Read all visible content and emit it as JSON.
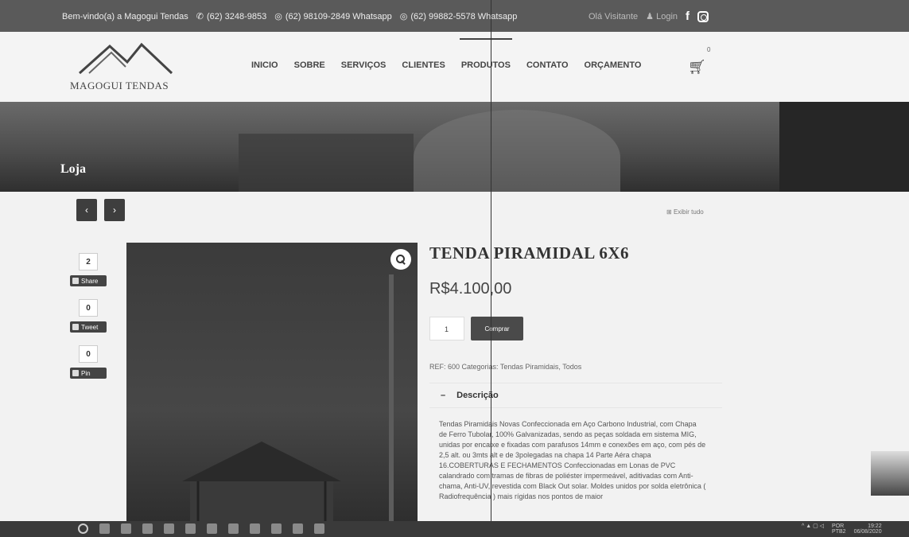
{
  "topbar": {
    "welcome": "Bem-vindo(a) a Magogui Tendas",
    "phone1": "(62) 3248-9853",
    "phone2": "(62) 98109-2849 Whatsapp",
    "phone3": "(62) 99882-5578 Whatsapp",
    "greeting": "Olá Visitante",
    "login": "Login"
  },
  "header": {
    "logo_text": "MAGOGUI TENDAS",
    "nav": [
      "INICIO",
      "SOBRE",
      "SERVIÇOS",
      "CLIENTES",
      "PRODUTOS",
      "CONTATO",
      "ORÇAMENTO"
    ],
    "active_nav": "PRODUTOS",
    "cart_count": "0"
  },
  "banner": {
    "title": "Loja"
  },
  "content": {
    "prev_label": "‹",
    "next_label": "›",
    "show_all": "Exibir tudo",
    "share": [
      {
        "count": "2",
        "label": "Share"
      },
      {
        "count": "0",
        "label": "Tweet"
      },
      {
        "count": "0",
        "label": "Pin"
      }
    ],
    "product": {
      "title": "TENDA PIRAMIDAL 6X6",
      "price": "R$4.100,00",
      "qty": "1",
      "buy_label": "Comprar",
      "meta": "REF: 600 Categorias: Tendas Piramidais, Todos",
      "desc_toggle": "–",
      "desc_heading": "Descrição",
      "description": "Tendas Piramidais Novas Confeccionada em Aço Carbono Industrial, com Chapa de Ferro Tubolar, 100% Galvanizadas, sendo as peças soldada em sistema MIG, unidas por encaixe e fixadas com parafusos 14mm e conexões em aço, com pés de 2,5 alt. ou 3mts alt e de 3polegadas na chapa 14 Parte Aéra chapa 16.COBERTURAS E FECHAMENTOS Confeccionadas em Lonas de PVC calandrado com tramas de fibras de poliéster impermeável, aditivadas com Anti-chama, Anti-UV, revestida com Black Out solar. Moldes unidos por solda eletrônica ( Radiofrequência ) mais rígidas nos pontos de maior"
    }
  },
  "taskbar": {
    "lang": "POR",
    "layout": "PTB2",
    "time": "19:22",
    "date": "06/08/2020"
  }
}
